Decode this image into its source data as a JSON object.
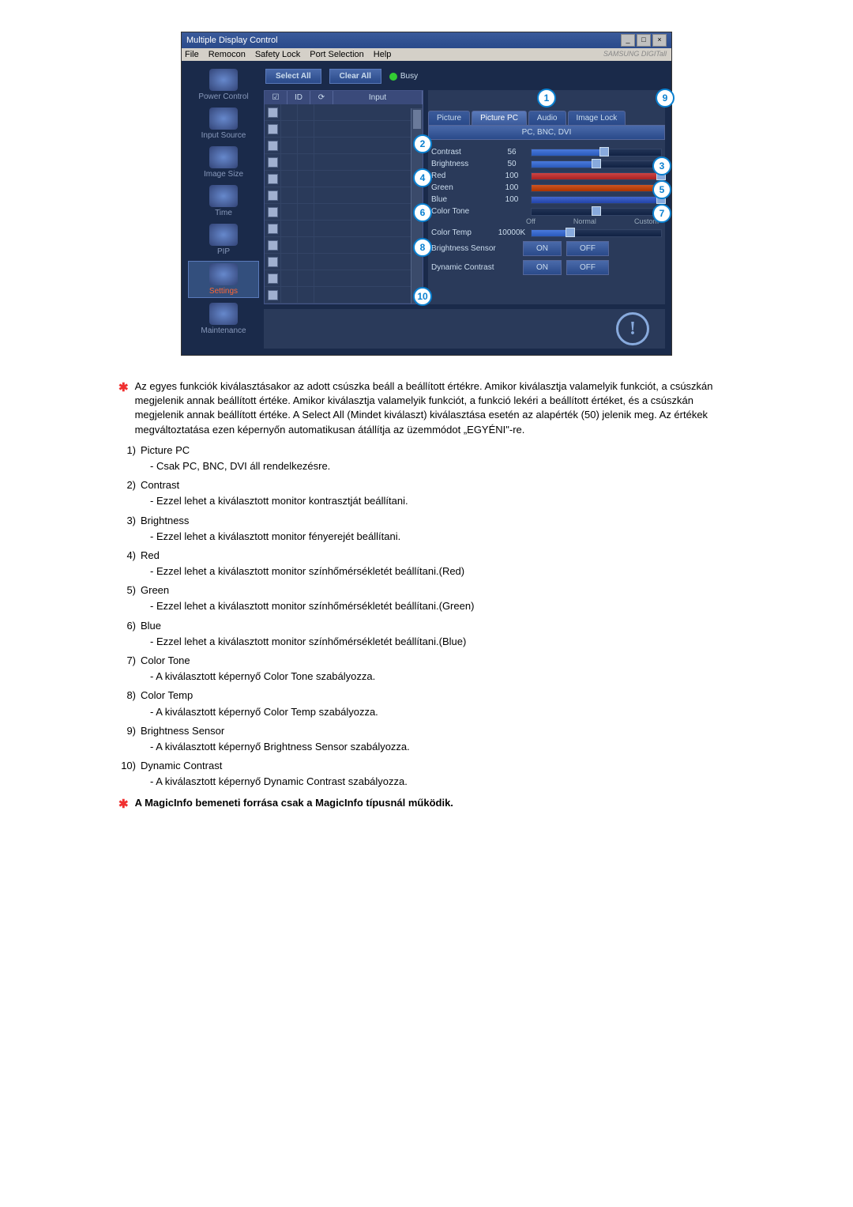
{
  "window": {
    "title": "Multiple Display Control",
    "menu": [
      "File",
      "Remocon",
      "Safety Lock",
      "Port Selection",
      "Help"
    ],
    "brand": "SAMSUNG DIGITall"
  },
  "sidebar": {
    "items": [
      {
        "label": "Power Control"
      },
      {
        "label": "Input Source"
      },
      {
        "label": "Image Size"
      },
      {
        "label": "Time"
      },
      {
        "label": "PIP"
      },
      {
        "label": "Settings",
        "active": true
      },
      {
        "label": "Maintenance"
      }
    ]
  },
  "toolbar": {
    "select_all": "Select All",
    "clear_all": "Clear All",
    "busy": "Busy"
  },
  "grid": {
    "headers": {
      "h1": "☑",
      "h2": "ID",
      "h3": "⟳",
      "h4": "Input"
    },
    "rows": 12
  },
  "tabs": {
    "items": [
      "Picture",
      "Picture PC",
      "Audio",
      "Image Lock"
    ],
    "active": "Picture PC",
    "strip": "PC, BNC, DVI"
  },
  "params": {
    "contrast": {
      "label": "Contrast",
      "value": "56",
      "pct": 56
    },
    "brightness": {
      "label": "Brightness",
      "value": "50",
      "pct": 50
    },
    "red": {
      "label": "Red",
      "value": "100",
      "pct": 100
    },
    "green": {
      "label": "Green",
      "value": "100",
      "pct": 100
    },
    "blue": {
      "label": "Blue",
      "value": "100",
      "pct": 100
    },
    "colortone": {
      "label": "Color Tone",
      "left": "Off",
      "mid": "Normal",
      "right": "Custom",
      "pct": 50
    },
    "colortemp": {
      "label": "Color Temp",
      "value": "10000K",
      "pct": 30
    }
  },
  "toggles": {
    "bsens": {
      "label": "Brightness Sensor",
      "on": "ON",
      "off": "OFF"
    },
    "dcon": {
      "label": "Dynamic Contrast",
      "on": "ON",
      "off": "OFF"
    }
  },
  "callouts": {
    "c1": "1",
    "c2": "2",
    "c3": "3",
    "c4": "4",
    "c5": "5",
    "c6": "6",
    "c7": "7",
    "c8": "8",
    "c9": "9",
    "c10": "10"
  },
  "desc": {
    "intro": "Az egyes funkciók kiválasztásakor az adott csúszka beáll a beállított értékre. Amikor kiválasztja valamelyik funkciót, a csúszkán megjelenik annak beállított értéke. Amikor kiválasztja valamelyik funkciót, a funkció lekéri a beállított értéket, és a csúszkán megjelenik annak beállított értéke. A Select All (Mindet kiválaszt) kiválasztása esetén az alapérték (50) jelenik meg. Az értékek megváltoztatása ezen képernyőn automatikusan átállítja az üzemmódot „EGYÉNI\"-re.",
    "items": [
      {
        "n": "1)",
        "t": "Picture PC",
        "s": "- Csak PC, BNC, DVI áll rendelkezésre."
      },
      {
        "n": "2)",
        "t": "Contrast",
        "s": "- Ezzel lehet a kiválasztott monitor kontrasztját beállítani."
      },
      {
        "n": "3)",
        "t": "Brightness",
        "s": "- Ezzel lehet a kiválasztott monitor fényerejét beállítani."
      },
      {
        "n": "4)",
        "t": "Red",
        "s": "- Ezzel lehet a kiválasztott monitor színhőmérsékletét beállítani.(Red)"
      },
      {
        "n": "5)",
        "t": "Green",
        "s": "- Ezzel lehet a kiválasztott monitor színhőmérsékletét beállítani.(Green)"
      },
      {
        "n": "6)",
        "t": "Blue",
        "s": "- Ezzel lehet a kiválasztott monitor színhőmérsékletét beállítani.(Blue)"
      },
      {
        "n": "7)",
        "t": "Color Tone",
        "s": "- A kiválasztott képernyő Color Tone szabályozza."
      },
      {
        "n": "8)",
        "t": "Color Temp",
        "s": "- A kiválasztott képernyő Color Temp szabályozza."
      },
      {
        "n": "9)",
        "t": "Brightness Sensor",
        "s": "- A kiválasztott képernyő Brightness Sensor szabályozza."
      },
      {
        "n": "10)",
        "t": "Dynamic Contrast",
        "s": "- A kiválasztott képernyő Dynamic Contrast szabályozza."
      }
    ],
    "note": "A MagicInfo bemeneti forrása csak a MagicInfo típusnál működik."
  }
}
